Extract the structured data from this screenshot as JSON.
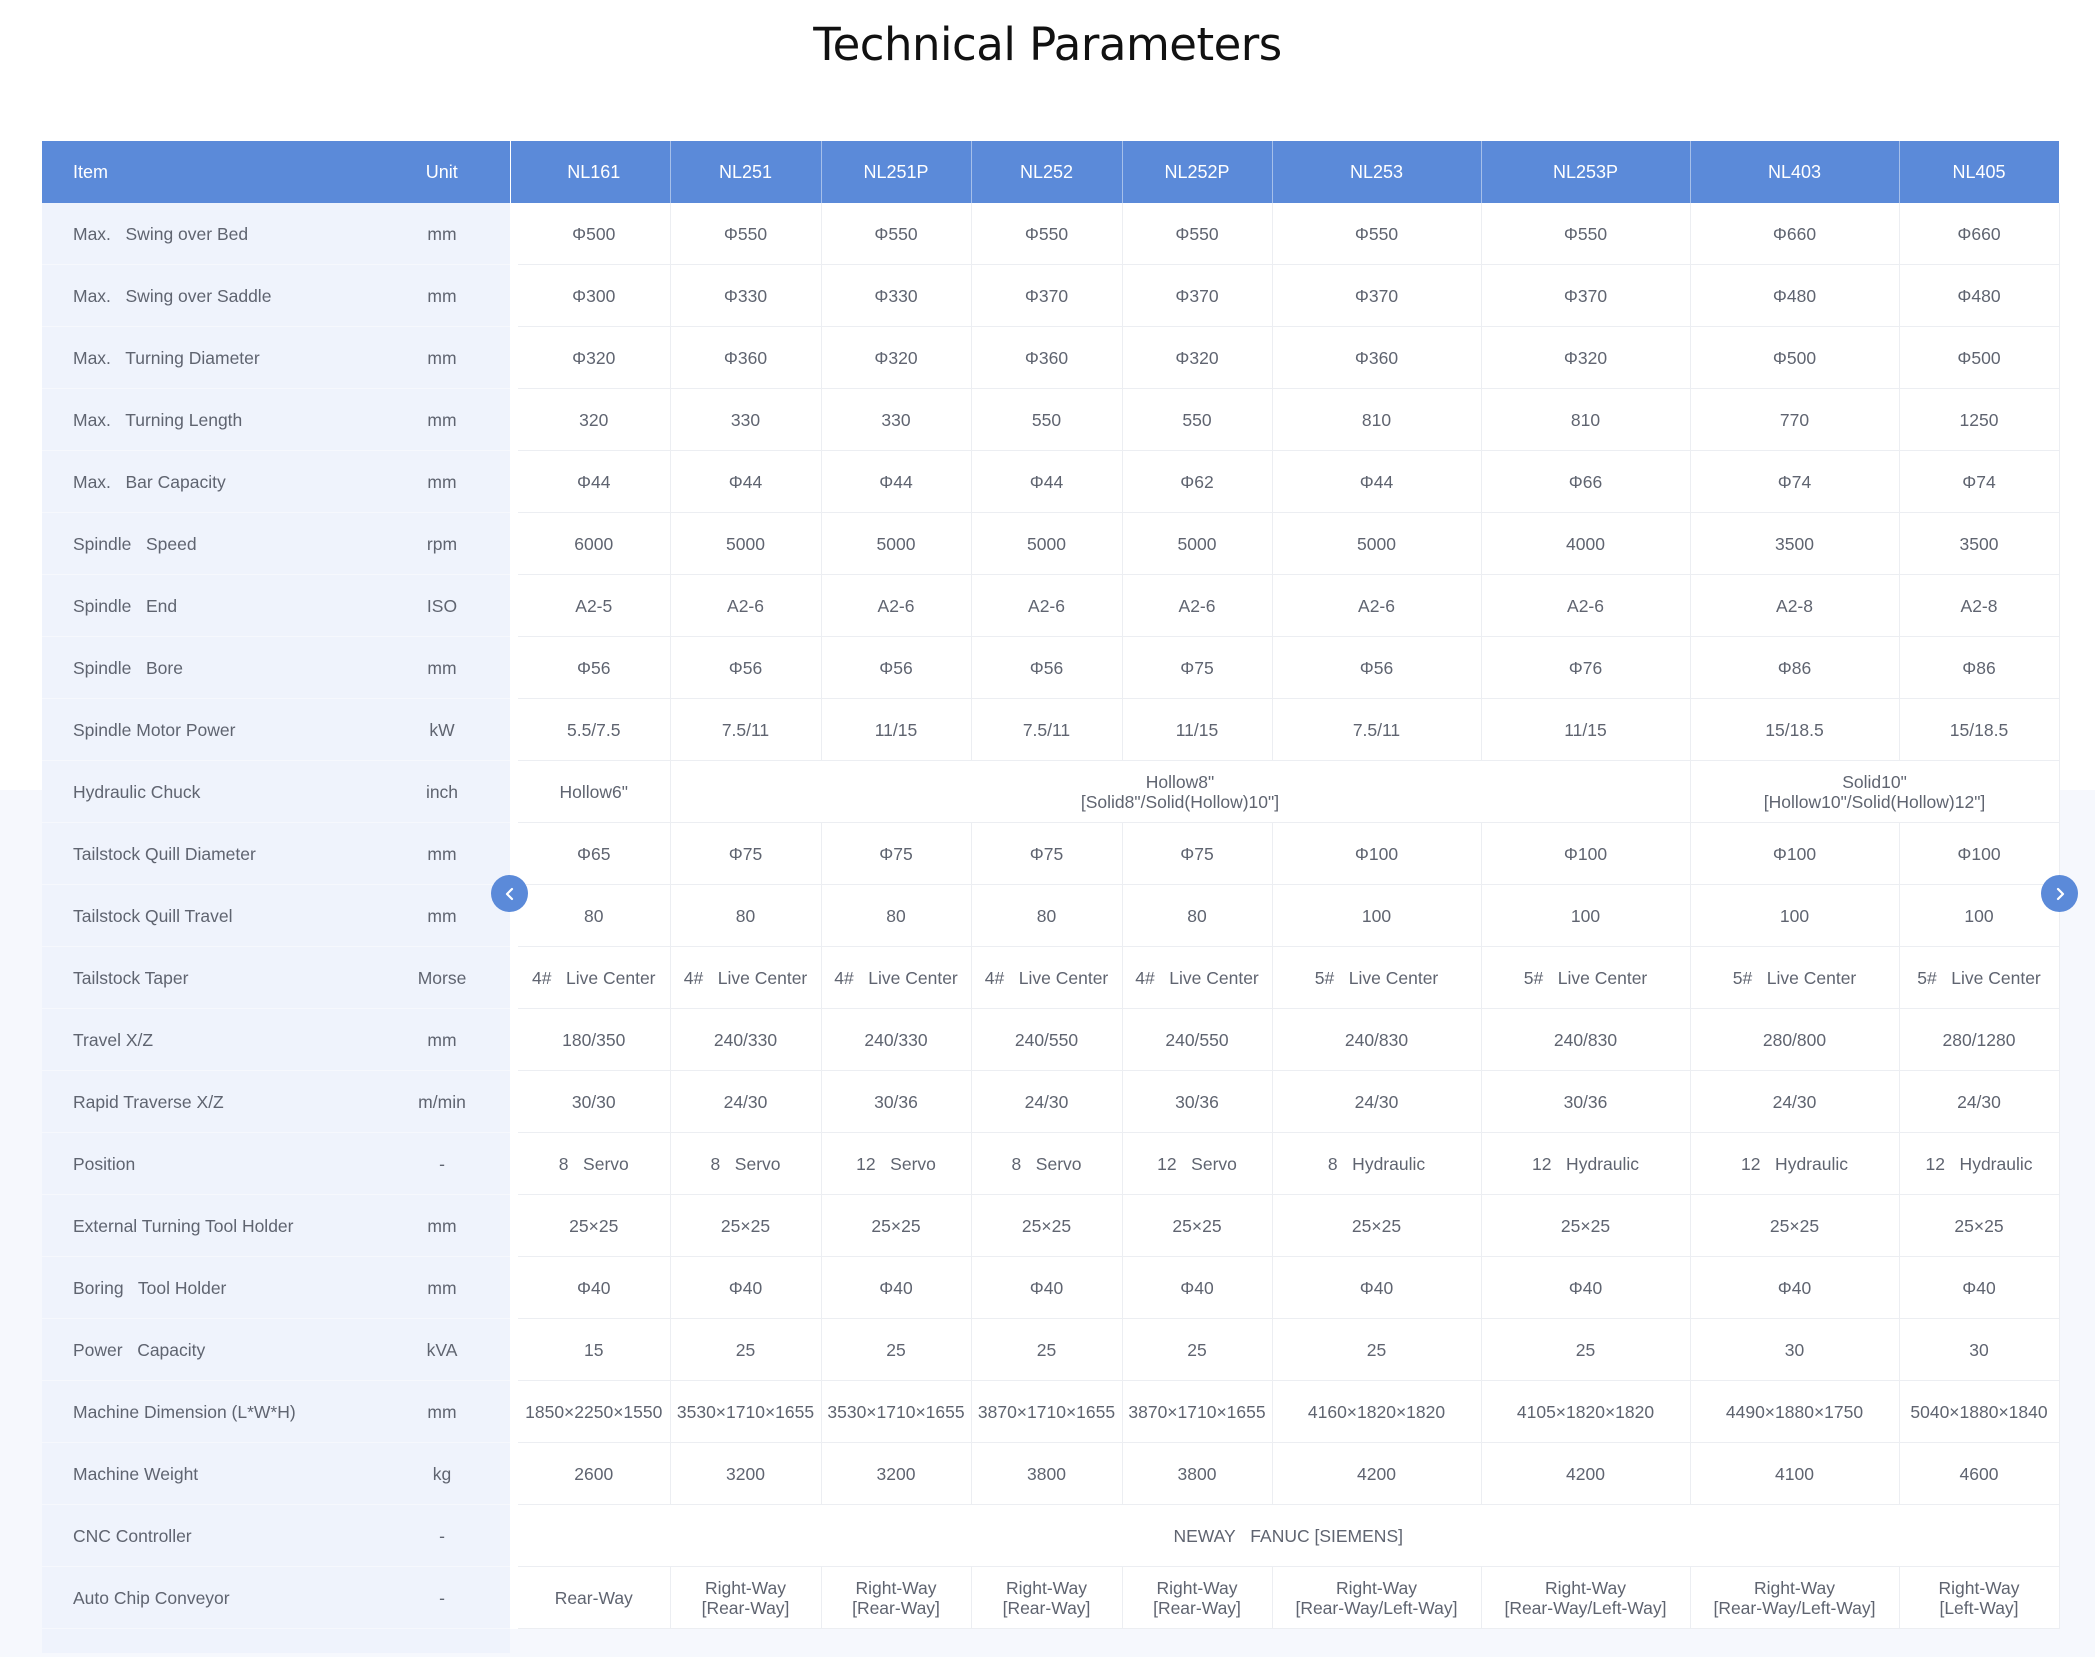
{
  "page": {
    "title": "Technical Parameters"
  },
  "table": {
    "header": {
      "item": "Item",
      "unit": "Unit",
      "models": [
        "NL161",
        "NL251",
        "NL251P",
        "NL252",
        "NL252P",
        "NL253",
        "NL253P",
        "NL403",
        "NL405"
      ]
    },
    "rows": [
      {
        "item": "Max.   Swing over Bed",
        "unit": "mm",
        "values": [
          "Φ500",
          "Φ550",
          "Φ550",
          "Φ550",
          "Φ550",
          "Φ550",
          "Φ550",
          "Φ660",
          "Φ660"
        ]
      },
      {
        "item": "Max.   Swing over Saddle",
        "unit": "mm",
        "values": [
          "Φ300",
          "Φ330",
          "Φ330",
          "Φ370",
          "Φ370",
          "Φ370",
          "Φ370",
          "Φ480",
          "Φ480"
        ]
      },
      {
        "item": "Max.   Turning Diameter",
        "unit": "mm",
        "values": [
          "Φ320",
          "Φ360",
          "Φ320",
          "Φ360",
          "Φ320",
          "Φ360",
          "Φ320",
          "Φ500",
          "Φ500"
        ]
      },
      {
        "item": "Max.   Turning Length",
        "unit": "mm",
        "values": [
          "320",
          "330",
          "330",
          "550",
          "550",
          "810",
          "810",
          "770",
          "1250"
        ]
      },
      {
        "item": "Max.   Bar Capacity",
        "unit": "mm",
        "values": [
          "Φ44",
          "Φ44",
          "Φ44",
          "Φ44",
          "Φ62",
          "Φ44",
          "Φ66",
          "Φ74",
          "Φ74"
        ]
      },
      {
        "item": "Spindle   Speed",
        "unit": "rpm",
        "values": [
          "6000",
          "5000",
          "5000",
          "5000",
          "5000",
          "5000",
          "4000",
          "3500",
          "3500"
        ]
      },
      {
        "item": "Spindle   End",
        "unit": "ISO",
        "values": [
          "A2-5",
          "A2-6",
          "A2-6",
          "A2-6",
          "A2-6",
          "A2-6",
          "A2-6",
          "A2-8",
          "A2-8"
        ]
      },
      {
        "item": "Spindle   Bore",
        "unit": "mm",
        "values": [
          "Φ56",
          "Φ56",
          "Φ56",
          "Φ56",
          "Φ75",
          "Φ56",
          "Φ76",
          "Φ86",
          "Φ86"
        ]
      },
      {
        "item": "Spindle Motor Power",
        "unit": "kW",
        "values": [
          "5.5/7.5",
          "7.5/11",
          "11/15",
          "7.5/11",
          "11/15",
          "7.5/11",
          "11/15",
          "15/18.5",
          "15/18.5"
        ]
      },
      {
        "item": "Hydraulic Chuck",
        "unit": "inch",
        "cells": [
          {
            "text": "Hollow6\"",
            "span": 1
          },
          {
            "text": "Hollow8\"\n[Solid8\"/Solid(Hollow)10\"]",
            "span": 6
          },
          {
            "text": "Solid10\"\n[Hollow10\"/Solid(Hollow)12\"]",
            "span": 2
          }
        ]
      },
      {
        "item": "Tailstock Quill Diameter",
        "unit": "mm",
        "values": [
          "Φ65",
          "Φ75",
          "Φ75",
          "Φ75",
          "Φ75",
          "Φ100",
          "Φ100",
          "Φ100",
          "Φ100"
        ]
      },
      {
        "item": "Tailstock Quill Travel",
        "unit": "mm",
        "values": [
          "80",
          "80",
          "80",
          "80",
          "80",
          "100",
          "100",
          "100",
          "100"
        ]
      },
      {
        "item": "Tailstock Taper",
        "unit": "Morse",
        "values": [
          "4#   Live Center",
          "4#   Live Center",
          "4#   Live Center",
          "4#   Live Center",
          "4#   Live Center",
          "5#   Live Center",
          "5#   Live Center",
          "5#   Live Center",
          "5#   Live Center"
        ]
      },
      {
        "item": "Travel X/Z",
        "unit": "mm",
        "values": [
          "180/350",
          "240/330",
          "240/330",
          "240/550",
          "240/550",
          "240/830",
          "240/830",
          "280/800",
          "280/1280"
        ]
      },
      {
        "item": "Rapid Traverse X/Z",
        "unit": "m/min",
        "values": [
          "30/30",
          "24/30",
          "30/36",
          "24/30",
          "30/36",
          "24/30",
          "30/36",
          "24/30",
          "24/30"
        ]
      },
      {
        "item": "Position",
        "unit": "-",
        "values": [
          "8   Servo",
          "8   Servo",
          "12   Servo",
          "8   Servo",
          "12   Servo",
          "8   Hydraulic",
          "12   Hydraulic",
          "12   Hydraulic",
          "12   Hydraulic"
        ]
      },
      {
        "item": "External Turning Tool Holder",
        "unit": "mm",
        "values": [
          "25×25",
          "25×25",
          "25×25",
          "25×25",
          "25×25",
          "25×25",
          "25×25",
          "25×25",
          "25×25"
        ]
      },
      {
        "item": "Boring   Tool Holder",
        "unit": "mm",
        "values": [
          "Φ40",
          "Φ40",
          "Φ40",
          "Φ40",
          "Φ40",
          "Φ40",
          "Φ40",
          "Φ40",
          "Φ40"
        ]
      },
      {
        "item": "Power   Capacity",
        "unit": "kVA",
        "values": [
          "15",
          "25",
          "25",
          "25",
          "25",
          "25",
          "25",
          "30",
          "30"
        ]
      },
      {
        "item": "Machine Dimension (L*W*H)",
        "unit": "mm",
        "values": [
          "1850×2250×1550",
          "3530×1710×1655",
          "3530×1710×1655",
          "3870×1710×1655",
          "3870×1710×1655",
          "4160×1820×1820",
          "4105×1820×1820",
          "4490×1880×1750",
          "5040×1880×1840"
        ]
      },
      {
        "item": "Machine Weight",
        "unit": "kg",
        "values": [
          "2600",
          "3200",
          "3200",
          "3800",
          "3800",
          "4200",
          "4200",
          "4100",
          "4600"
        ]
      },
      {
        "item": "CNC Controller",
        "unit": "-",
        "cells": [
          {
            "text": "NEWAY   FANUC [SIEMENS]",
            "span": 9
          }
        ]
      },
      {
        "item": "Auto Chip Conveyor",
        "unit": "-",
        "values": [
          "Rear-Way",
          "Right-Way\n[Rear-Way]",
          "Right-Way\n[Rear-Way]",
          "Right-Way\n[Rear-Way]",
          "Right-Way\n[Rear-Way]",
          "Right-Way\n[Rear-Way/Left-Way]",
          "Right-Way\n[Rear-Way/Left-Way]",
          "Right-Way\n[Rear-Way/Left-Way]",
          "Right-Way\n[Left-Way]"
        ]
      }
    ]
  },
  "nav": {
    "prev_icon": "chevron-left-icon",
    "next_icon": "chevron-right-icon"
  },
  "colors": {
    "header_bg": "#5b8ad9",
    "label_bg": "#eff3fc",
    "accent": "#5b8ad9"
  }
}
